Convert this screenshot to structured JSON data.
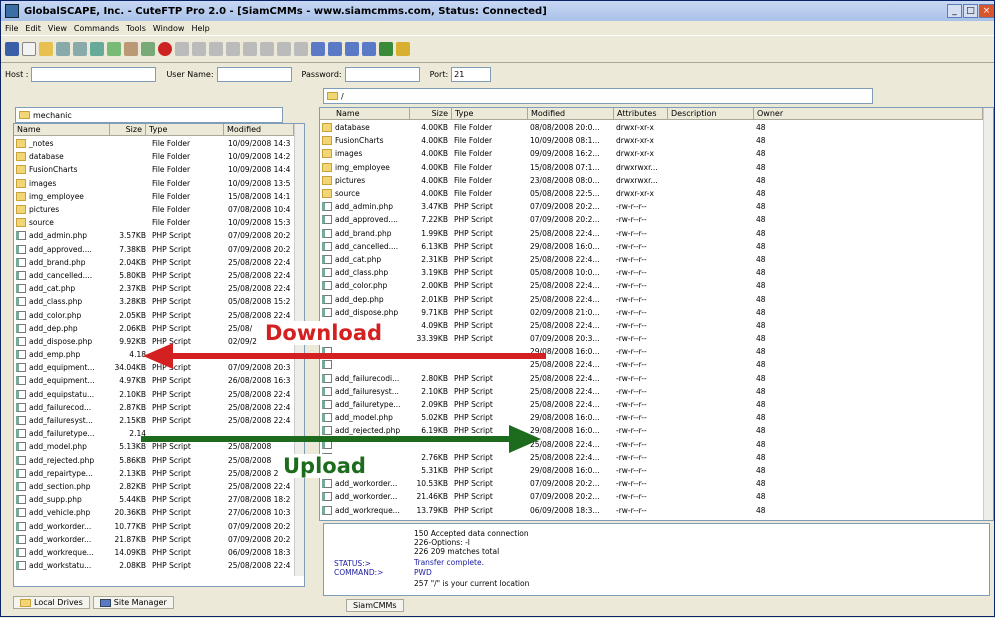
{
  "window": {
    "title": "GlobalSCAPE, Inc. - CuteFTP Pro 2.0 - [SiamCMMs - www.siamcmms.com, Status: Connected]",
    "controls": [
      "_",
      "□",
      "×"
    ]
  },
  "menu": [
    "File",
    "Edit",
    "View",
    "Commands",
    "Tools",
    "Window",
    "Help"
  ],
  "connection": {
    "host_label": "Host :",
    "user_label": "User Name:",
    "password_label": "Password:",
    "port_label": "Port:",
    "port_value": "21"
  },
  "local": {
    "path": "mechanic",
    "headers": [
      "Name",
      "Size",
      "Type",
      "Modified"
    ],
    "rows": [
      [
        "_notes",
        "",
        "File Folder",
        "10/09/2008 14:3",
        "f"
      ],
      [
        "database",
        "",
        "File Folder",
        "10/09/2008 14:2",
        "f"
      ],
      [
        "FusionCharts",
        "",
        "File Folder",
        "10/09/2008 14:4",
        "f"
      ],
      [
        "images",
        "",
        "File Folder",
        "10/09/2008 13:5",
        "f"
      ],
      [
        "img_employee",
        "",
        "File Folder",
        "15/08/2008 14:1",
        "f"
      ],
      [
        "pictures",
        "",
        "File Folder",
        "07/08/2008 10:4",
        "f"
      ],
      [
        "source",
        "",
        "File Folder",
        "10/09/2008 15:3",
        "f"
      ],
      [
        "add_admin.php",
        "3.57KB",
        "PHP Script",
        "07/09/2008 20:2",
        "p"
      ],
      [
        "add_approved....",
        "7.38KB",
        "PHP Script",
        "07/09/2008 20:2",
        "p"
      ],
      [
        "add_brand.php",
        "2.04KB",
        "PHP Script",
        "25/08/2008 22:4",
        "p"
      ],
      [
        "add_cancelled....",
        "5.80KB",
        "PHP Script",
        "25/08/2008 22:4",
        "p"
      ],
      [
        "add_cat.php",
        "2.37KB",
        "PHP Script",
        "25/08/2008 22:4",
        "p"
      ],
      [
        "add_class.php",
        "3.28KB",
        "PHP Script",
        "05/08/2008 15:2",
        "p"
      ],
      [
        "add_color.php",
        "2.05KB",
        "PHP Script",
        "25/08/2008 22:4",
        "p"
      ],
      [
        "add_dep.php",
        "2.06KB",
        "PHP Script",
        "25/08/",
        "p"
      ],
      [
        "add_dispose.php",
        "9.92KB",
        "PHP Script",
        "02/09/2",
        "p"
      ],
      [
        "add_emp.php",
        "4.18",
        "",
        "",
        "p"
      ],
      [
        "add_equipment...",
        "34.04KB",
        "PHP Script",
        "07/09/2008 20:3",
        "p"
      ],
      [
        "add_equipment...",
        "4.97KB",
        "PHP Script",
        "26/08/2008 16:3",
        "p"
      ],
      [
        "add_equipstatu...",
        "2.10KB",
        "PHP Script",
        "25/08/2008 22:4",
        "p"
      ],
      [
        "add_failurecod...",
        "2.87KB",
        "PHP Script",
        "25/08/2008 22:4",
        "p"
      ],
      [
        "add_failuresyst...",
        "2.15KB",
        "PHP Script",
        "25/08/2008 22:4",
        "p"
      ],
      [
        "add_failuretype...",
        "2.14",
        "",
        "",
        "p"
      ],
      [
        "add_model.php",
        "5.13KB",
        "PHP Script",
        "25/08/2008",
        "p"
      ],
      [
        "add_rejected.php",
        "5.86KB",
        "PHP Script",
        "25/08/2008",
        "p"
      ],
      [
        "add_repairtype...",
        "2.13KB",
        "PHP Script",
        "25/08/2008 2",
        "p"
      ],
      [
        "add_section.php",
        "2.82KB",
        "PHP Script",
        "25/08/2008 22:4",
        "p"
      ],
      [
        "add_supp.php",
        "5.44KB",
        "PHP Script",
        "27/08/2008 18:2",
        "p"
      ],
      [
        "add_vehicle.php",
        "20.36KB",
        "PHP Script",
        "27/06/2008 10:3",
        "p"
      ],
      [
        "add_workorder...",
        "10.77KB",
        "PHP Script",
        "07/09/2008 20:2",
        "p"
      ],
      [
        "add_workorder...",
        "21.87KB",
        "PHP Script",
        "07/09/2008 20:2",
        "p"
      ],
      [
        "add_workreque...",
        "14.09KB",
        "PHP Script",
        "06/09/2008 18:3",
        "p"
      ],
      [
        "add_workstatu...",
        "2.08KB",
        "PHP Script",
        "25/08/2008 22:4",
        "p"
      ]
    ]
  },
  "remote": {
    "path": "/",
    "headers": [
      "Name",
      "Size",
      "Type",
      "Modified",
      "Attributes",
      "Description",
      "Owner"
    ],
    "rows": [
      [
        "database",
        "4.00KB",
        "File Folder",
        "08/08/2008 20:0...",
        "drwxr-xr-x",
        "48",
        "f"
      ],
      [
        "FusionCharts",
        "4.00KB",
        "File Folder",
        "10/09/2008 08:1...",
        "drwxr-xr-x",
        "48",
        "f"
      ],
      [
        "images",
        "4.00KB",
        "File Folder",
        "09/09/2008 16:2...",
        "drwxr-xr-x",
        "48",
        "f"
      ],
      [
        "img_employee",
        "4.00KB",
        "File Folder",
        "15/08/2008 07:1...",
        "drwxrwxr...",
        "48",
        "f"
      ],
      [
        "pictures",
        "4.00KB",
        "File Folder",
        "23/08/2008 08:0...",
        "drwxrwxr...",
        "48",
        "f"
      ],
      [
        "source",
        "4.00KB",
        "File Folder",
        "05/08/2008 22:5...",
        "drwxr-xr-x",
        "48",
        "f"
      ],
      [
        "add_admin.php",
        "3.47KB",
        "PHP Script",
        "07/09/2008 20:2...",
        "-rw-r--r--",
        "48",
        "p"
      ],
      [
        "add_approved....",
        "7.22KB",
        "PHP Script",
        "07/09/2008 20:2...",
        "-rw-r--r--",
        "48",
        "p"
      ],
      [
        "add_brand.php",
        "1.99KB",
        "PHP Script",
        "25/08/2008 22:4...",
        "-rw-r--r--",
        "48",
        "p"
      ],
      [
        "add_cancelled....",
        "6.13KB",
        "PHP Script",
        "29/08/2008 16:0...",
        "-rw-r--r--",
        "48",
        "p"
      ],
      [
        "add_cat.php",
        "2.31KB",
        "PHP Script",
        "25/08/2008 22:4...",
        "-rw-r--r--",
        "48",
        "p"
      ],
      [
        "add_class.php",
        "3.19KB",
        "PHP Script",
        "05/08/2008 10:0...",
        "-rw-r--r--",
        "48",
        "p"
      ],
      [
        "add_color.php",
        "2.00KB",
        "PHP Script",
        "25/08/2008 22:4...",
        "-rw-r--r--",
        "48",
        "p"
      ],
      [
        "add_dep.php",
        "2.01KB",
        "PHP Script",
        "25/08/2008 22:4...",
        "-rw-r--r--",
        "48",
        "p"
      ],
      [
        "add_dispose.php",
        "9.71KB",
        "PHP Script",
        "02/09/2008 21:0...",
        "-rw-r--r--",
        "48",
        "p"
      ],
      [
        "",
        "4.09KB",
        "PHP Script",
        "25/08/2008 22:4...",
        "-rw-r--r--",
        "48",
        "p"
      ],
      [
        "",
        "33.39KB",
        "PHP Script",
        "07/09/2008 20:3...",
        "-rw-r--r--",
        "48",
        "p"
      ],
      [
        "",
        "",
        "",
        "29/08/2008 16:0...",
        "-rw-r--r--",
        "48",
        "p"
      ],
      [
        "",
        "",
        "",
        "25/08/2008 22:4...",
        "-rw-r--r--",
        "48",
        "p"
      ],
      [
        "add_failurecodi...",
        "2.80KB",
        "PHP Script",
        "25/08/2008 22:4...",
        "-rw-r--r--",
        "48",
        "p"
      ],
      [
        "add_failuresyst...",
        "2.10KB",
        "PHP Script",
        "25/08/2008 22:4...",
        "-rw-r--r--",
        "48",
        "p"
      ],
      [
        "add_failuretype...",
        "2.09KB",
        "PHP Script",
        "25/08/2008 22:4...",
        "-rw-r--r--",
        "48",
        "p"
      ],
      [
        "add_model.php",
        "5.02KB",
        "PHP Script",
        "29/08/2008 16:0...",
        "-rw-r--r--",
        "48",
        "p"
      ],
      [
        "add_rejected.php",
        "6.19KB",
        "PHP Script",
        "29/08/2008 16:0...",
        "-rw-r--r--",
        "48",
        "p"
      ],
      [
        "",
        "",
        "",
        "25/08/2008 22:4...",
        "-rw-r--r--",
        "48",
        "p"
      ],
      [
        "",
        "2.76KB",
        "PHP Script",
        "25/08/2008 22:4...",
        "-rw-r--r--",
        "48",
        "p"
      ],
      [
        "",
        "5.31KB",
        "PHP Script",
        "29/08/2008 16:0...",
        "-rw-r--r--",
        "48",
        "p"
      ],
      [
        "add_workorder...",
        "10.53KB",
        "PHP Script",
        "07/09/2008 20:2...",
        "-rw-r--r--",
        "48",
        "p"
      ],
      [
        "add_workorder...",
        "21.46KB",
        "PHP Script",
        "07/09/2008 20:2...",
        "-rw-r--r--",
        "48",
        "p"
      ],
      [
        "add_workreque...",
        "13.79KB",
        "PHP Script",
        "06/09/2008 18:3...",
        "-rw-r--r--",
        "48",
        "p"
      ]
    ]
  },
  "log": {
    "lines": [
      "150 Accepted data connection",
      "226-Options: -l",
      "226 209 matches total",
      "Transfer complete.",
      "PWD",
      "257 \"/\" is your current location"
    ],
    "status_label": "STATUS:>",
    "command_label": "COMMAND:>"
  },
  "tabs": {
    "local_drives": "Local Drives",
    "site_manager": "Site Manager",
    "session": "SiamCMMs"
  },
  "annotations": {
    "download": "Download",
    "upload": "Upload"
  },
  "colors": {
    "download_arrow": "#d42020",
    "upload_arrow": "#1d6b1d",
    "upload_text": "#1d6b1d",
    "download_text": "#d42020",
    "status_text": "#1a1aa0"
  }
}
